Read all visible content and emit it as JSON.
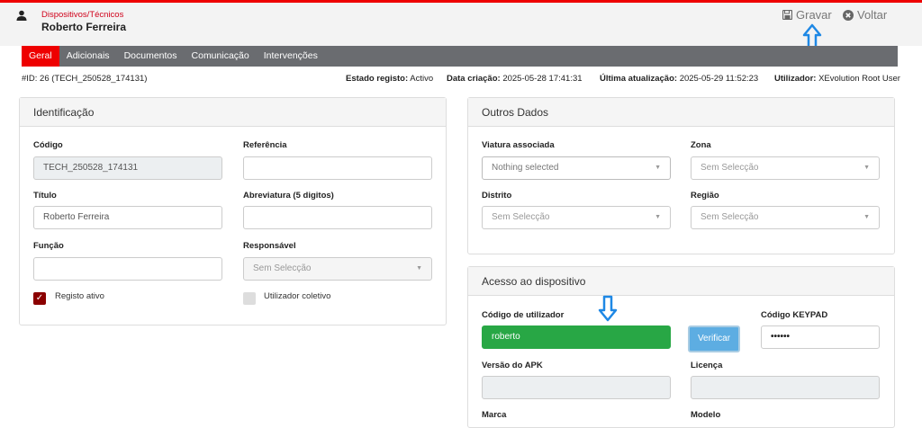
{
  "header": {
    "breadcrumb": "Dispositivos/Técnicos",
    "title": "Roberto Ferreira",
    "save_label": "Gravar",
    "back_label": "Voltar"
  },
  "tabs": [
    "Geral",
    "Adicionais",
    "Documentos",
    "Comunicação",
    "Intervenções"
  ],
  "meta": {
    "id_text": "#ID: 26 (TECH_250528_174131)",
    "estado_label": "Estado registo:",
    "estado_value": "Activo",
    "criacao_label": "Data criação:",
    "criacao_value": "2025-05-28 17:41:31",
    "atualizacao_label": "Última atualização:",
    "atualizacao_value": "2025-05-29 11:52:23",
    "utilizador_label": "Utilizador:",
    "utilizador_value": "XEvolution Root User"
  },
  "identificacao": {
    "title": "Identificação",
    "codigo_label": "Código",
    "codigo_value": "TECH_250528_174131",
    "referencia_label": "Referência",
    "referencia_value": "",
    "titulo_label": "Título",
    "titulo_value": "Roberto Ferreira",
    "abreviatura_label": "Abreviatura (5 digitos)",
    "abreviatura_value": "",
    "funcao_label": "Função",
    "funcao_value": "",
    "responsavel_label": "Responsável",
    "responsavel_value": "Sem Selecção",
    "registo_ativo_label": "Registo ativo",
    "utilizador_coletivo_label": "Utilizador coletivo"
  },
  "outros": {
    "title": "Outros Dados",
    "viatura_label": "Viatura associada",
    "viatura_value": "Nothing selected",
    "zona_label": "Zona",
    "zona_value": "Sem Selecção",
    "distrito_label": "Distrito",
    "distrito_value": "Sem Selecção",
    "regiao_label": "Região",
    "regiao_value": "Sem Selecção"
  },
  "acesso": {
    "title": "Acesso ao dispositivo",
    "codigo_utilizador_label": "Código de utilizador",
    "codigo_utilizador_value": "roberto",
    "verificar_label": "Verificar",
    "keypad_label": "Código KEYPAD",
    "keypad_value": "••••••",
    "apk_label": "Versão do APK",
    "licenca_label": "Licença",
    "marca_label": "Marca",
    "modelo_label": "Modelo"
  },
  "colors": {
    "accent": "#e00000",
    "tabbar": "#6a6c70",
    "success": "#28a745",
    "arrow": "#1e88e5"
  }
}
